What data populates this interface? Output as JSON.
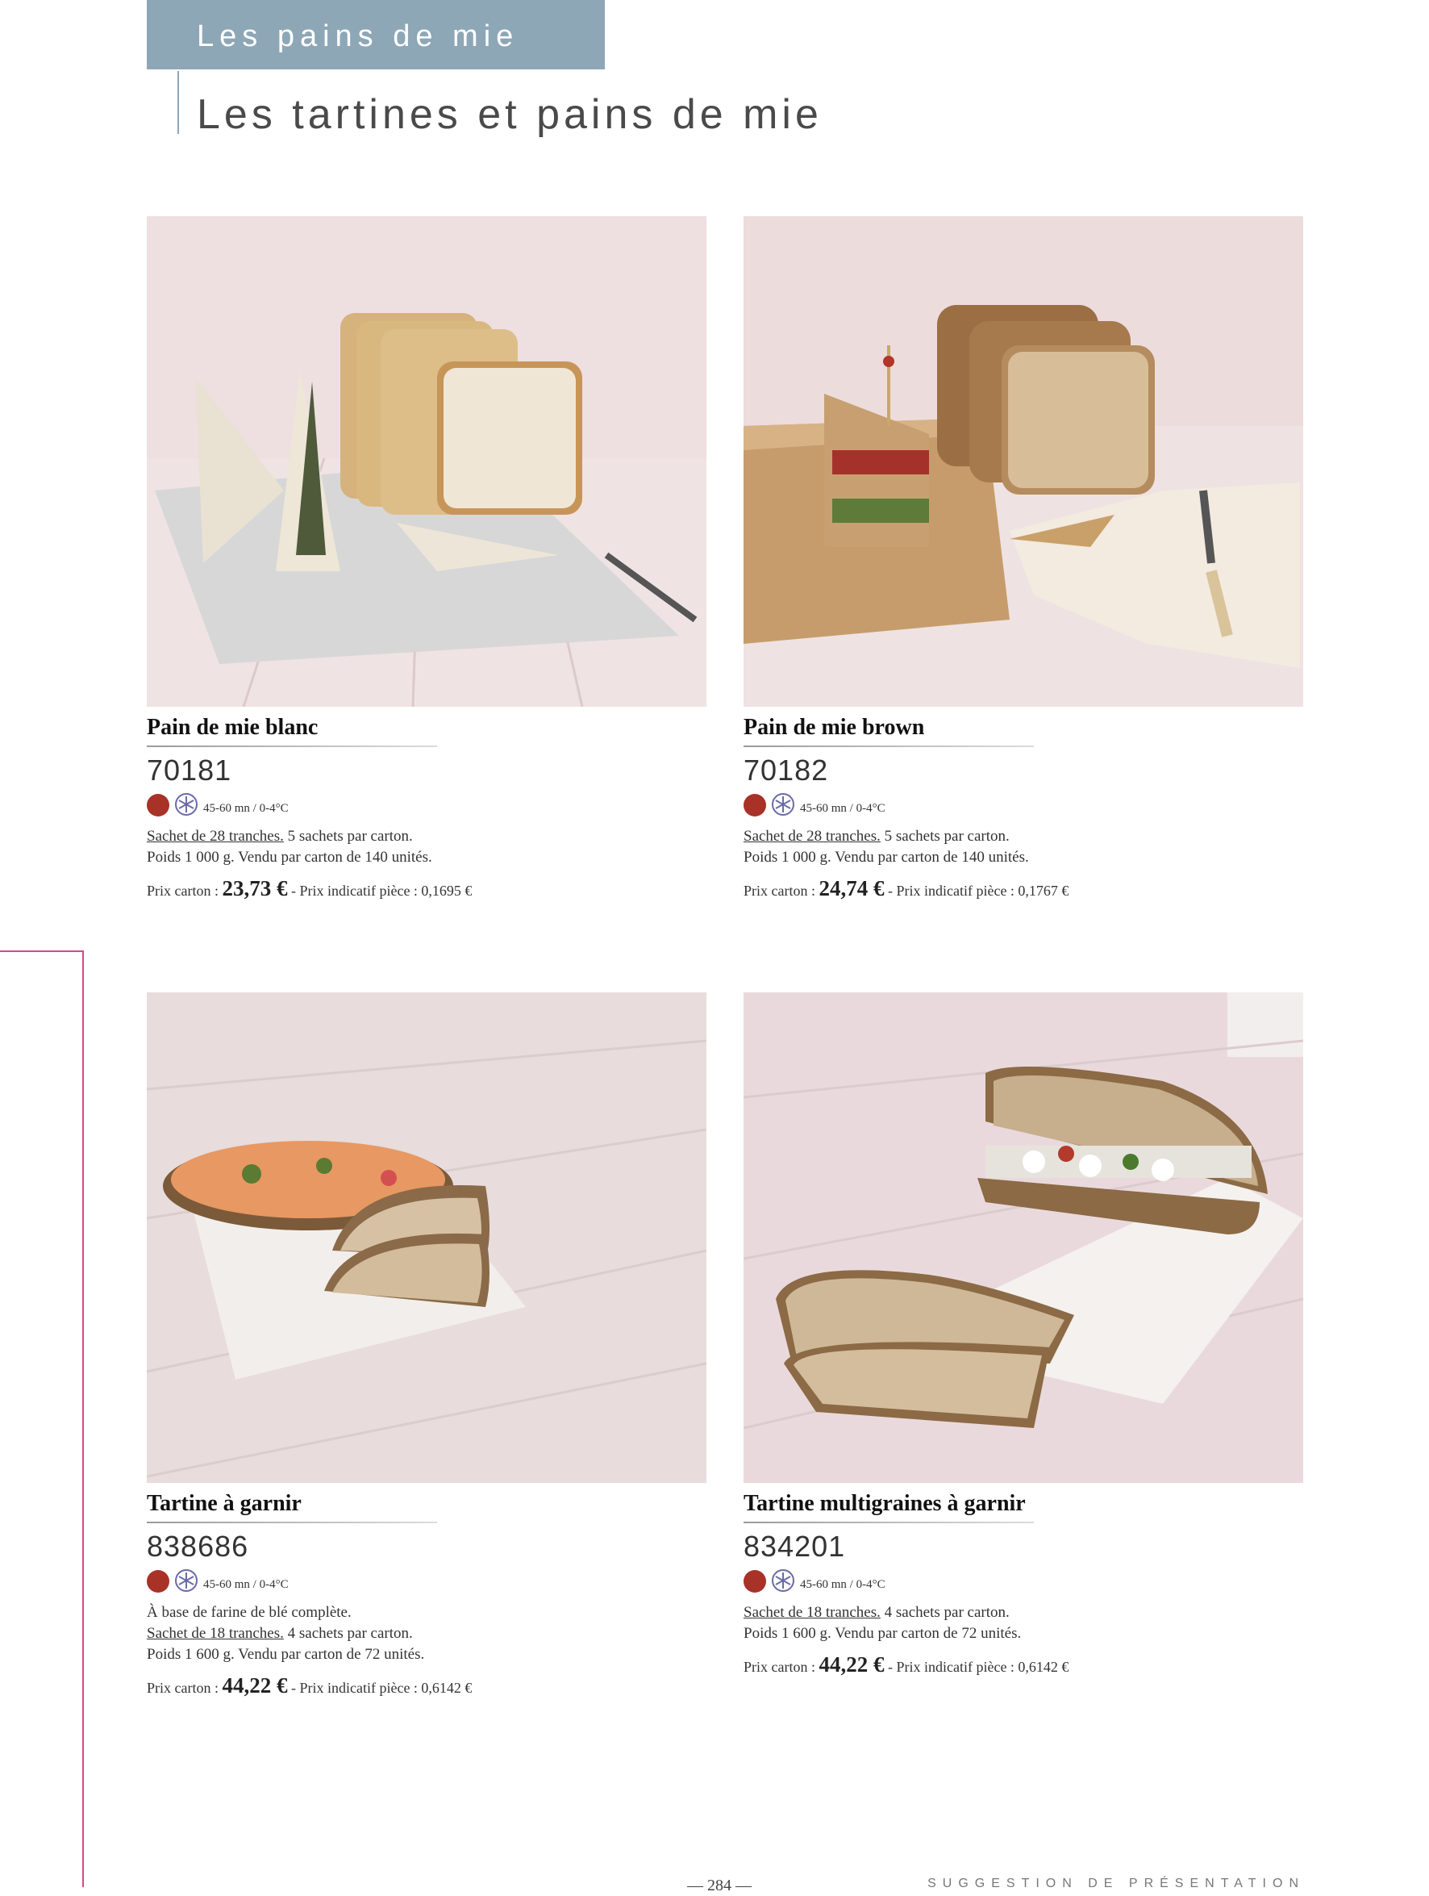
{
  "header": {
    "section_title": "Les pains de mie",
    "subtitle": "Les tartines et pains de mie"
  },
  "products": [
    {
      "name": "Pain de mie blanc",
      "code": "70181",
      "temperature": "45-60 mn / 0-4°C",
      "desc_extra": "",
      "pack_underlined": "Sachet de 28 tranches.",
      "pack_rest": " 5 sachets par carton.",
      "weight": "Poids 1 000 g. Vendu par carton de 140 unités.",
      "price_label": "Prix carton : ",
      "price_value": "23,73 €",
      "unit_price": " - Prix indicatif pièce : 0,1695 €",
      "photo_icon": "white-sandwich-bread-photo"
    },
    {
      "name": "Pain de mie brown",
      "code": "70182",
      "temperature": "45-60 mn / 0-4°C",
      "desc_extra": "",
      "pack_underlined": "Sachet de 28 tranches.",
      "pack_rest": " 5 sachets par carton.",
      "weight": "Poids 1 000 g. Vendu par carton de 140 unités.",
      "price_label": "Prix carton : ",
      "price_value": "24,74 €",
      "unit_price": " - Prix indicatif pièce : 0,1767 €",
      "photo_icon": "brown-sandwich-bread-photo"
    },
    {
      "name": "Tartine à garnir",
      "code": "838686",
      "temperature": "45-60 mn / 0-4°C",
      "desc_extra": "À base de farine de blé complète.",
      "pack_underlined": "Sachet de 18 tranches.",
      "pack_rest": " 4 sachets par carton.",
      "weight": "Poids 1 600 g. Vendu par carton de 72 unités.",
      "price_label": "Prix carton : ",
      "price_value": "44,22 €",
      "unit_price": " - Prix indicatif pièce : 0,6142 €",
      "photo_icon": "tartine-photo"
    },
    {
      "name": "Tartine multigraines à garnir",
      "code": "834201",
      "temperature": "45-60 mn / 0-4°C",
      "desc_extra": "",
      "pack_underlined": "Sachet de 18 tranches.",
      "pack_rest": " 4 sachets par carton.",
      "weight": "Poids 1 600 g. Vendu par carton de 72 unités.",
      "price_label": "Prix carton : ",
      "price_value": "44,22 €",
      "unit_price": " - Prix indicatif pièce : 0,6142 €",
      "photo_icon": "multigrain-tartine-photo"
    }
  ],
  "footer": {
    "page_number": "284",
    "note": "SUGGESTION DE PRÉSENTATION"
  },
  "colors": {
    "section_tab": "#8da7b7",
    "thawing_dot": "#a83227",
    "margin_line": "#d9468a"
  }
}
